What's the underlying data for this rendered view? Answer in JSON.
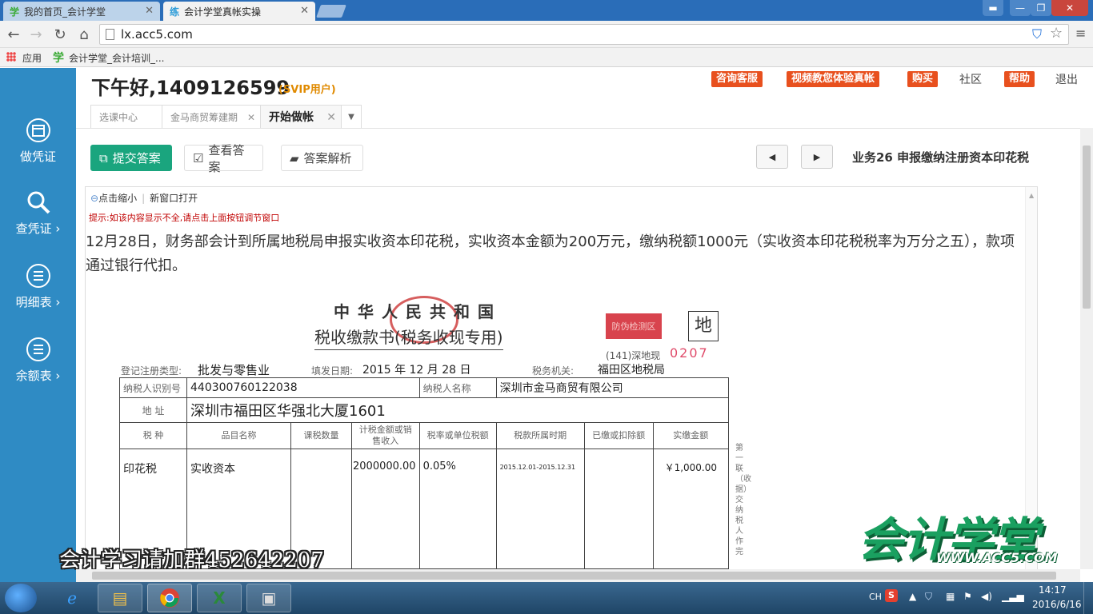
{
  "browser": {
    "tabs": [
      {
        "icon": "学",
        "title": "我的首页_会计学堂"
      },
      {
        "icon": "练",
        "title": "会计学堂真帐实操"
      }
    ],
    "url": "lx.acc5.com",
    "bookmarks": [
      {
        "label": "应用"
      },
      {
        "icon": "学",
        "label": "会计学堂_会计培训_..."
      }
    ]
  },
  "sidebar": {
    "items": [
      {
        "label": "做凭证",
        "icon": "calendar-icon"
      },
      {
        "label": "查凭证 ›",
        "icon": "search-icon"
      },
      {
        "label": "明细表 ›",
        "icon": "list-icon"
      },
      {
        "label": "余额表 ›",
        "icon": "list-icon"
      }
    ]
  },
  "header": {
    "greeting": "下午好,1409126599",
    "user_level": "(SVIP用户)",
    "buttons": [
      "咨询客服",
      "视频教您体验真帐",
      "购买",
      "社区",
      "帮助",
      "退出"
    ]
  },
  "app_tabs": [
    "选课中心",
    "金马商贸筹建期",
    "开始做帐"
  ],
  "actions": {
    "submit": "提交答案",
    "view": "查看答案",
    "analysis": "答案解析",
    "task_title": "业务26  申报缴纳注册资本印花税"
  },
  "frame": {
    "zoom_out": "点击缩小",
    "new_window": "新窗口打开",
    "hint": "提示:如该内容显示不全,请点击上面按钮调节窗口",
    "question": "12月28日，财务部会计到所属地税局申报实收资本印花税，实收资本金额为200万元，缴纳税额1000元（实收资本印花税税率为万分之五），款项通过银行代扣。"
  },
  "tax_form": {
    "title_country": "中华人民共和国",
    "title_doc": "税收缴款书(税务收现专用)",
    "red_stamp": "防伪检测区",
    "box_char": "地",
    "code_prefix": "(141)深地现",
    "code_number": "0207",
    "reg_type_label": "登记注册类型:",
    "reg_type": "批发与零售业",
    "date_label": "填发日期:",
    "date": "2015 年  12  月  28  日",
    "tax_office_label": "税务机关:",
    "tax_office": "福田区地税局",
    "taxpayer_id_label": "纳税人识别号",
    "taxpayer_id": "440300760122038",
    "taxpayer_name_label": "纳税人名称",
    "taxpayer_name": "深圳市金马商贸有限公司",
    "address_label": "地    址",
    "address": "深圳市福田区华强北大厦1601",
    "columns": [
      "税    种",
      "品目名称",
      "课税数量",
      "计税金额或销售收入",
      "税率或单位税额",
      "税款所属时期",
      "已缴或扣除额",
      "实缴金额"
    ],
    "rows": [
      {
        "tax_type": "印花税",
        "item": "实收资本",
        "quantity": "",
        "taxable_amount": "2000000.00",
        "rate": "0.05%",
        "period": "2015.12.01-2015.12.31",
        "deducted": "",
        "actual": "￥1,000.00"
      }
    ],
    "side_note": "第一联（收据）交纳税人作完"
  },
  "watermark": {
    "group_text": "会计学习请加群452642207",
    "logo": "会计学堂",
    "logo_url": "WWW.ACC5.COM"
  },
  "taskbar": {
    "lang": "CH",
    "tray_s": "S",
    "time": "14:17",
    "date": "2016/6/16"
  }
}
